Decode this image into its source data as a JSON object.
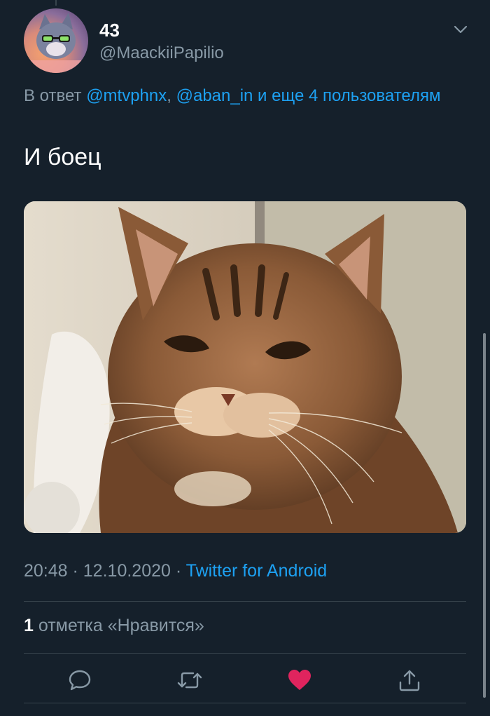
{
  "user": {
    "display_name": "43",
    "handle": "@MaackiiPapilio"
  },
  "reply": {
    "prefix": "В ответ ",
    "mention_1": "@mtvphnx",
    "separator": ", ",
    "mention_2": "@aban_in",
    "suffix": " и еще 4 пользователям"
  },
  "tweet": {
    "text": "И боец",
    "time": "20:48",
    "dot_1": " · ",
    "date": "12.10.2020",
    "dot_2": " · ",
    "source": "Twitter for Android"
  },
  "likes": {
    "count": "1",
    "label": " отметка «Нравится»"
  },
  "icons": {
    "menu": "chevron-down-icon",
    "reply": "comment-icon",
    "retweet": "retweet-icon",
    "like": "heart-icon",
    "share": "share-icon"
  },
  "colors": {
    "background": "#15202b",
    "link": "#1da1f2",
    "secondary_text": "#8899a6",
    "like_active": "#e0245e",
    "divider": "#38444d"
  }
}
